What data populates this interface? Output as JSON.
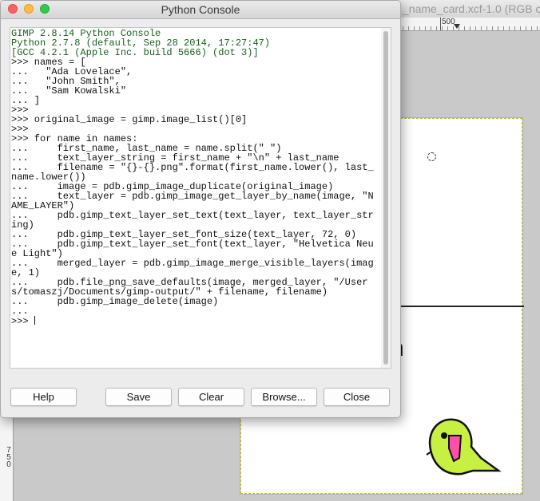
{
  "background_window": {
    "title": "_name_card.xcf-1.0 (RGB col",
    "ruler_top_label": "500",
    "ruler_left_label": "750"
  },
  "console": {
    "title": "Python Console",
    "lines": [
      "GIMP 2.8.14 Python Console",
      "Python 2.7.8 (default, Sep 28 2014, 17:27:47)",
      "[GCC 4.2.1 (Apple Inc. build 5666) (dot 3)]",
      ">>> names = [",
      "...   \"Ada Lovelace\",",
      "...   \"John Smith\",",
      "...   \"Sam Kowalski\"",
      "... ]",
      ">>>",
      ">>> original_image = gimp.image_list()[0]",
      ">>>",
      ">>> for name in names:",
      "...     first_name, last_name = name.split(\" \")",
      "...     text_layer_string = first_name + \"\\n\" + last_name",
      "...     filename = \"{}-{}.png\".format(first_name.lower(), last_",
      "name.lower())",
      "...     image = pdb.gimp_image_duplicate(original_image)",
      "...     text_layer = pdb.gimp_image_get_layer_by_name(image, \"N",
      "AME_LAYER\")",
      "...     pdb.gimp_text_layer_set_text(text_layer, text_layer_str",
      "ing)",
      "...     pdb.gimp_text_layer_set_font_size(text_layer, 72, 0)",
      "...     pdb.gimp_text_layer_set_font(text_layer, \"Helvetica Neu",
      "e Light\")",
      "...     merged_layer = pdb.gimp_image_merge_visible_layers(imag",
      "e, 1)",
      "...     pdb.file_png_save_defaults(image, merged_layer, \"/User",
      "s/tomaszj/Documents/gimp-output/\" + filename, filename)",
      "...     pdb.gimp_image_delete(image)",
      "...",
      ">>> "
    ],
    "buttons": {
      "help": "Help",
      "save": "Save",
      "clear": "Clear",
      "browse": "Browse...",
      "close": "Close"
    }
  },
  "icons": {
    "parrot": "party-parrot-icon",
    "window_controls": [
      "close-dot-icon",
      "minimize-dot-icon",
      "zoom-dot-icon"
    ]
  },
  "colors": {
    "parrot_body": "#c8f043",
    "parrot_beak": "#ff4fa8",
    "traffic_close": "#fc605c",
    "traffic_min": "#fdbc40",
    "traffic_max": "#34c84a"
  }
}
